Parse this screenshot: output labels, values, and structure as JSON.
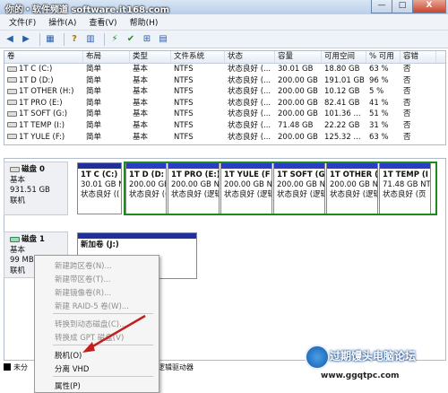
{
  "watermark": "你的・软件频道 software.it168.com",
  "window_buttons": [
    "—",
    "□",
    "X"
  ],
  "menubar": [
    "文件(F)",
    "操作(A)",
    "查看(V)",
    "帮助(H)"
  ],
  "volume_columns": [
    "卷",
    "布局",
    "类型",
    "文件系统",
    "状态",
    "容量",
    "可用空间",
    "% 可用",
    "容错"
  ],
  "volumes": [
    {
      "name": "1T C (C:)",
      "layout": "简单",
      "type": "基本",
      "fs": "NTFS",
      "status": "状态良好 (...",
      "capacity": "30.01 GB",
      "free": "18.80 GB",
      "pct": "63 %",
      "ft": "否"
    },
    {
      "name": "1T D (D:)",
      "layout": "简单",
      "type": "基本",
      "fs": "NTFS",
      "status": "状态良好 (...",
      "capacity": "200.00 GB",
      "free": "191.01 GB",
      "pct": "96 %",
      "ft": "否"
    },
    {
      "name": "1T OTHER (H:)",
      "layout": "简单",
      "type": "基本",
      "fs": "NTFS",
      "status": "状态良好 (...",
      "capacity": "200.00 GB",
      "free": "10.12 GB",
      "pct": "5 %",
      "ft": "否"
    },
    {
      "name": "1T PRO (E:)",
      "layout": "简单",
      "type": "基本",
      "fs": "NTFS",
      "status": "状态良好 (...",
      "capacity": "200.00 GB",
      "free": "82.41 GB",
      "pct": "41 %",
      "ft": "否"
    },
    {
      "name": "1T SOFT (G:)",
      "layout": "简单",
      "type": "基本",
      "fs": "NTFS",
      "status": "状态良好 (...",
      "capacity": "200.00 GB",
      "free": "101.36 ...",
      "pct": "51 %",
      "ft": "否"
    },
    {
      "name": "1T TEMP (I:)",
      "layout": "简单",
      "type": "基本",
      "fs": "NTFS",
      "status": "状态良好 (...",
      "capacity": "71.48 GB",
      "free": "22.22 GB",
      "pct": "31 %",
      "ft": "否"
    },
    {
      "name": "1T YULE (F:)",
      "layout": "简单",
      "type": "基本",
      "fs": "NTFS",
      "status": "状态良好 (...",
      "capacity": "200.00 GB",
      "free": "125.32 ...",
      "pct": "63 %",
      "ft": "否"
    }
  ],
  "disk0": {
    "name": "磁盘 0",
    "type": "基本",
    "size": "931.51 GB",
    "status": "联机"
  },
  "disk0_parts": [
    {
      "title": "1T C  (C:)",
      "size": "30.01 GB NT",
      "status": "状态良好 (("
    },
    {
      "title": "1T D  (D:",
      "size": "200.00 GB N",
      "status": "状态良好 (("
    },
    {
      "title": "1T PRO  (E:)",
      "size": "200.00 GB N",
      "status": "状态良好 (逻辑"
    },
    {
      "title": "1T YULE  (F",
      "size": "200.00 GB N",
      "status": "状态良好 (逻辑"
    },
    {
      "title": "1T SOFT  (G",
      "size": "200.00 GB N",
      "status": "状态良好 (逻辑"
    },
    {
      "title": "1T OTHER  (I",
      "size": "200.00 GB N",
      "status": "状态良好 (逻辑"
    },
    {
      "title": "1T TEMP  (I",
      "size": "71.48 GB NT",
      "status": "状态良好 (页"
    }
  ],
  "disk1": {
    "name": "磁盘 1",
    "type": "基本",
    "size": "99 MB",
    "status": "联机"
  },
  "disk1_part": {
    "title": "新加卷  (J:)"
  },
  "context_menu": [
    {
      "label": "新建跨区卷(N)...",
      "enabled": false
    },
    {
      "label": "新建带区卷(T)...",
      "enabled": false
    },
    {
      "label": "新建镜像卷(R)...",
      "enabled": false
    },
    {
      "label": "新建 RAID-5 卷(W)...",
      "enabled": false
    },
    {
      "label": "转换到动态磁盘(C)...",
      "enabled": false
    },
    {
      "label": "转换成 GPT 磁盘(V)",
      "enabled": false
    },
    {
      "label": "脱机(O)",
      "enabled": true
    },
    {
      "label": "分离 VHD",
      "enabled": true
    },
    {
      "label": "属性(P)",
      "enabled": true
    }
  ],
  "legend": [
    {
      "label": "未分",
      "color": "#000000"
    },
    {
      "label": "逻辑驱动器",
      "color": "#2a3cc8"
    }
  ],
  "brand": {
    "name": "过期馒头电脑论坛",
    "url": "www.ggqtpc.com"
  },
  "colors": {
    "primary_partition": "#20309a",
    "extended_border": "#1d8a1d",
    "arrow": "#c0201e"
  }
}
